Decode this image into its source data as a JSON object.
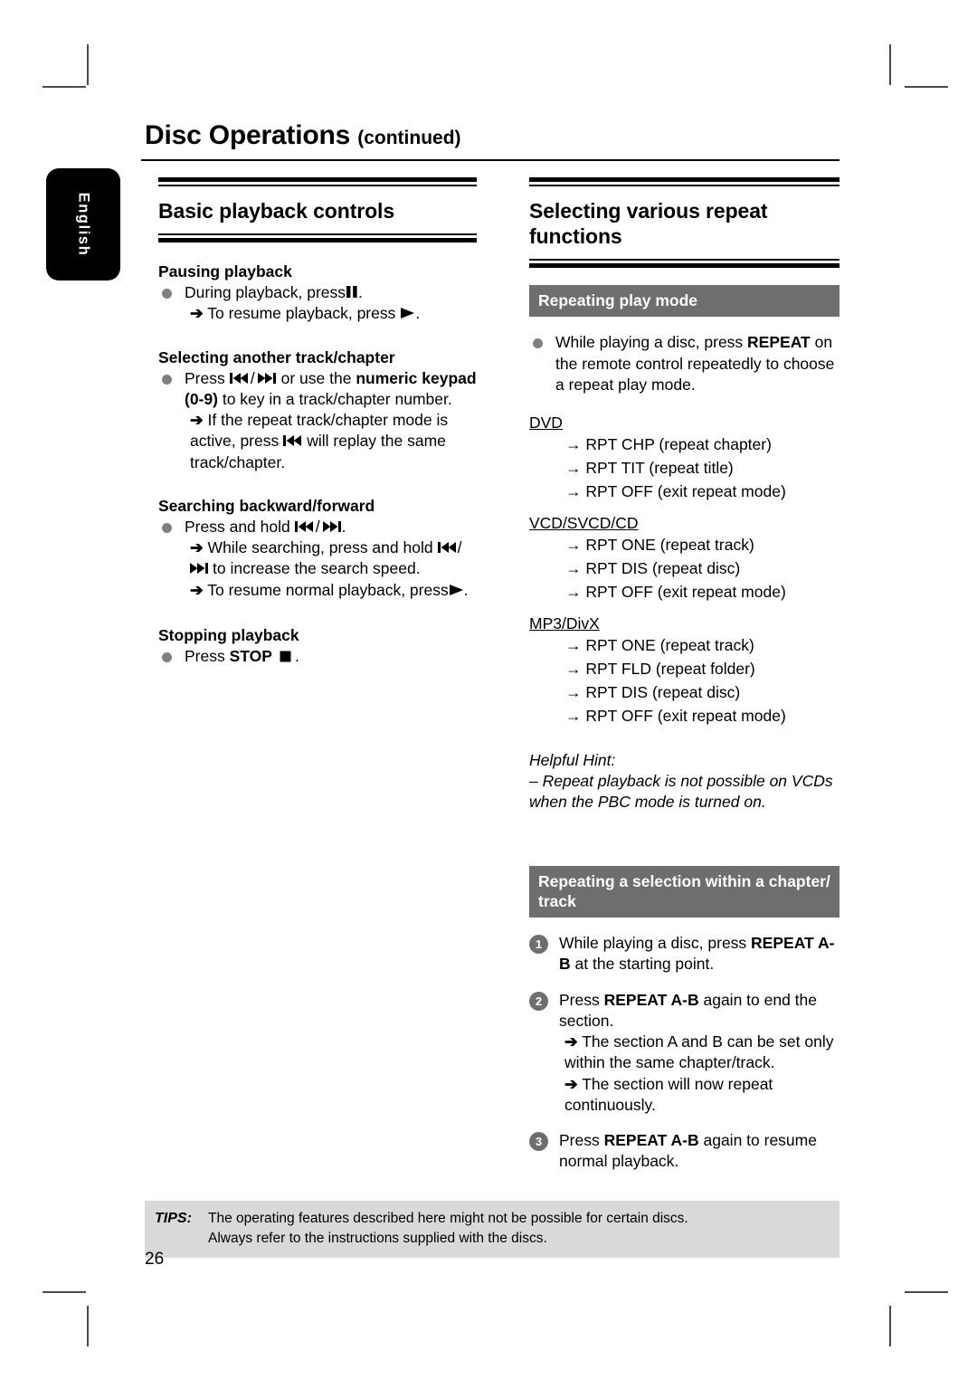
{
  "page": {
    "title": "Disc Operations",
    "title_suffix": "(continued)",
    "language_tab": "English",
    "page_number": "26"
  },
  "left_column": {
    "heading": "Basic playback controls",
    "sections": [
      {
        "subheading": "Pausing playback",
        "bullet": "During playback, press",
        "bullet_icon": "pause-icon",
        "bullet_suffix": ".",
        "arrows": [
          {
            "text": "To resume playback, press",
            "icon": "play-icon",
            "suffix": "."
          }
        ]
      },
      {
        "subheading": "Selecting another track/chapter",
        "bullet_pre": "Press",
        "icon_prev": "previous-track-icon",
        "icon_sep": "/",
        "icon_next": "next-track-icon",
        "bullet_mid": "or use the",
        "bullet_bold": "numeric keypad (0-9)",
        "bullet_post": "to key in a track/chapter number.",
        "arrow_pre": "If the repeat track/chapter mode is active, press",
        "arrow_icon": "previous-track-icon",
        "arrow_post": "will replay the same track/chapter."
      },
      {
        "subheading": "Searching backward/forward",
        "bullet_pre": "Press and hold",
        "icon_prev": "previous-track-icon",
        "icon_sep": "/",
        "icon_next": "next-track-icon",
        "bullet_post": ".",
        "arrow1_pre": "While searching, press and hold",
        "arrow1_icon_a": "previous-track-icon",
        "arrow1_sep": "/",
        "arrow1_icon_b": "next-track-icon",
        "arrow1_post": "to increase the search speed.",
        "arrow2_pre": "To resume normal playback, press",
        "arrow2_icon": "play-icon",
        "arrow2_post": "."
      },
      {
        "subheading": "Stopping playback",
        "bullet_pre": "Press",
        "bullet_bold": "STOP",
        "bullet_icon": "stop-icon",
        "bullet_post": "."
      }
    ]
  },
  "right_column": {
    "heading": "Selecting various repeat functions",
    "repeating_play_mode": {
      "bar_title": "Repeating play mode",
      "bullet_pre": "While playing a disc, press",
      "bullet_bold": "REPEAT",
      "bullet_post": "on the remote control repeatedly to choose a repeat play mode.",
      "groups": [
        {
          "label": "DVD",
          "items": [
            "RPT CHP (repeat chapter)",
            "RPT TIT (repeat title)",
            "RPT OFF (exit repeat mode)"
          ]
        },
        {
          "label": "VCD/SVCD/CD",
          "items": [
            "RPT ONE (repeat track)",
            "RPT DIS (repeat disc)",
            "RPT OFF (exit repeat mode)"
          ]
        },
        {
          "label": "MP3/DivX",
          "items": [
            "RPT ONE (repeat track)",
            "RPT FLD (repeat folder)",
            "RPT DIS (repeat disc)",
            "RPT OFF (exit repeat mode)"
          ]
        }
      ],
      "hint_label": "Helpful Hint:",
      "hint_text": "– Repeat playback is not possible on VCDs when the PBC mode is turned on."
    },
    "repeating_selection": {
      "bar_title": "Repeating a selection within a chapter/ track",
      "steps": [
        {
          "num": "1",
          "pre": "While playing a disc, press",
          "bold": "REPEAT A-B",
          "post": "at the starting point.",
          "arrows": []
        },
        {
          "num": "2",
          "pre": "Press",
          "bold": "REPEAT A-B",
          "post": "again to end the section.",
          "arrows": [
            "The section A and B can be set only within the same chapter/track.",
            "The section will now repeat continuously."
          ]
        },
        {
          "num": "3",
          "pre": "Press",
          "bold": "REPEAT A-B",
          "post": "again to resume normal playback.",
          "arrows": []
        }
      ]
    }
  },
  "tips": {
    "label": "TIPS:",
    "line1": "The operating features described here might not be possible for certain discs.",
    "line2": "Always refer to the instructions supplied with the discs."
  },
  "colors": {
    "gray_bar": "#6e6e6e",
    "bullet": "#808080",
    "tips_bg": "#d9d9d9",
    "tab_bg": "#000000"
  }
}
